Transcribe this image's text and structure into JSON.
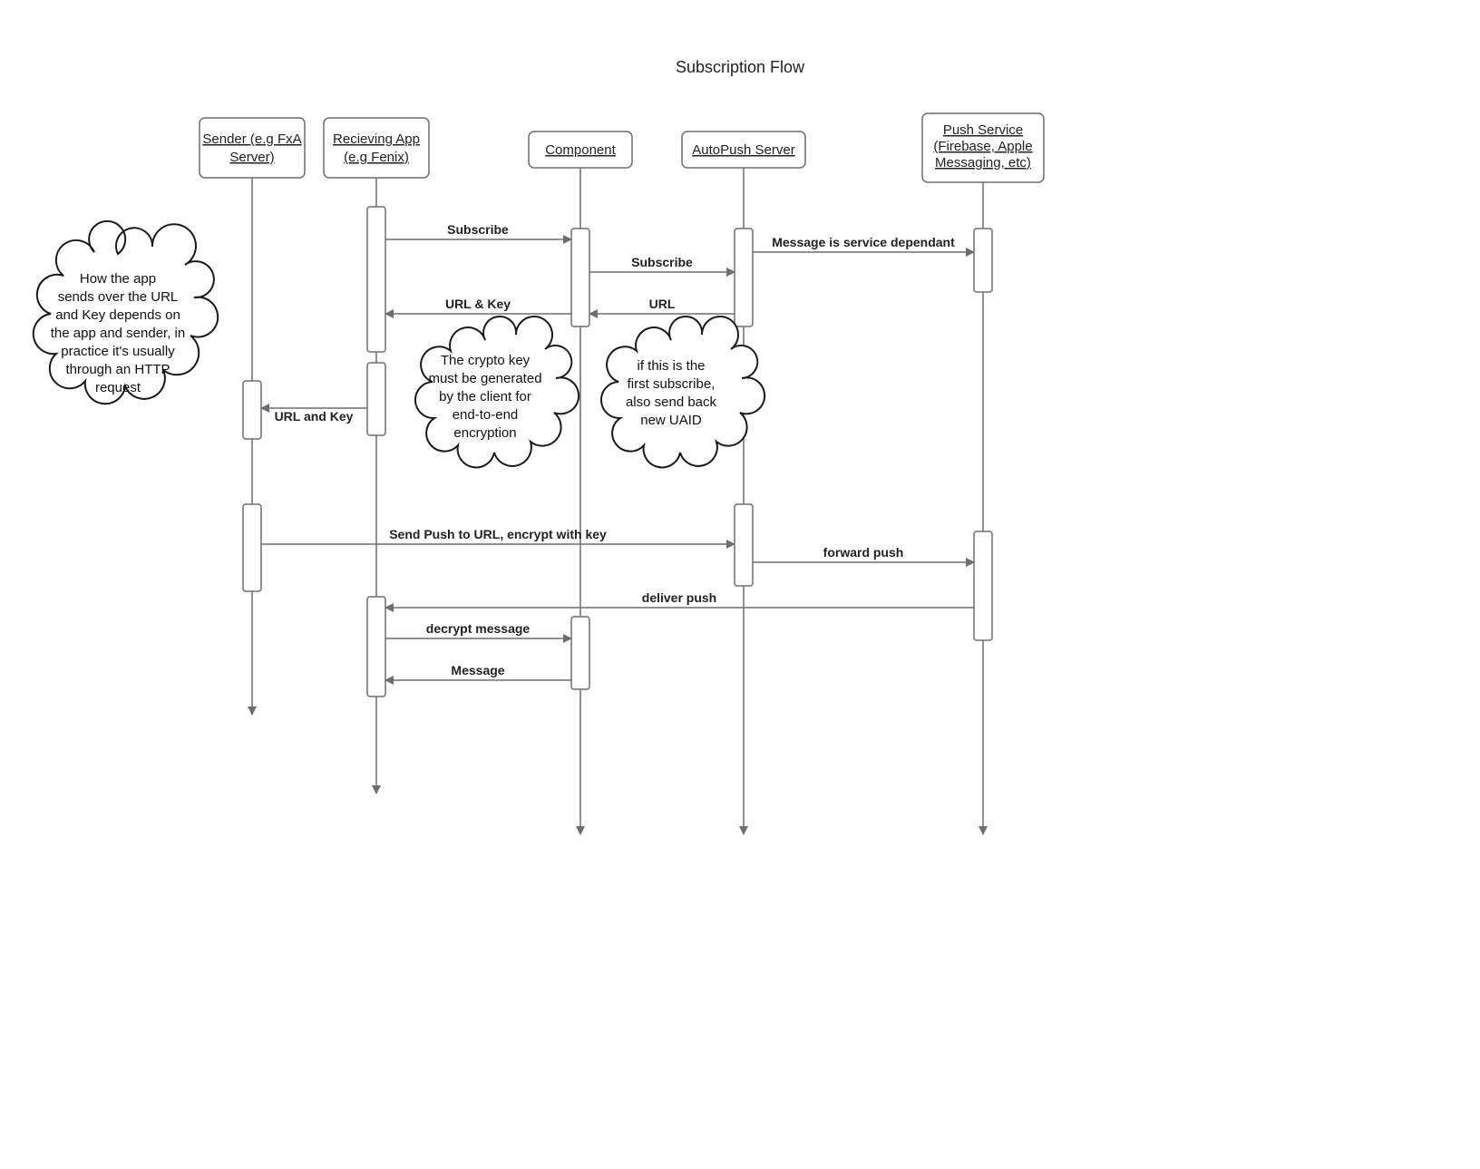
{
  "title": "Subscription Flow",
  "lanes": {
    "sender": {
      "line1": "Sender (e.g FxA",
      "line2": "Server)"
    },
    "app": {
      "line1": "Recieving App",
      "line2": "(e.g Fenix)"
    },
    "comp": {
      "line1": "Component"
    },
    "auto": {
      "line1": "AutoPush Server"
    },
    "push": {
      "line1": "Push Service",
      "line2": "(Firebase, Apple",
      "line3": "Messaging, etc)"
    }
  },
  "messages": {
    "m1": "Subscribe",
    "m2": "Message is service dependant",
    "m3": "Subscribe",
    "m4": "URL",
    "m5": "URL & Key",
    "m6": "URL and Key",
    "m7": "Send Push to URL, encrypt with key",
    "m8": "forward push",
    "m9": "deliver push",
    "m10": "decrypt message",
    "m11": "Message"
  },
  "clouds": {
    "c1": {
      "l1": "How the app",
      "l2": "sends over the URL",
      "l3": "and Key depends on",
      "l4": "the app and sender, in",
      "l5": "practice it's usually",
      "l6": "through an HTTP",
      "l7": "request"
    },
    "c2": {
      "l1": "The crypto key",
      "l2": "must be generated",
      "l3": "by the client for",
      "l4": "end-to-end",
      "l5": "encryption"
    },
    "c3": {
      "l1": "if this is the",
      "l2": "first subscribe,",
      "l3": "also send back",
      "l4": "new UAID"
    }
  }
}
